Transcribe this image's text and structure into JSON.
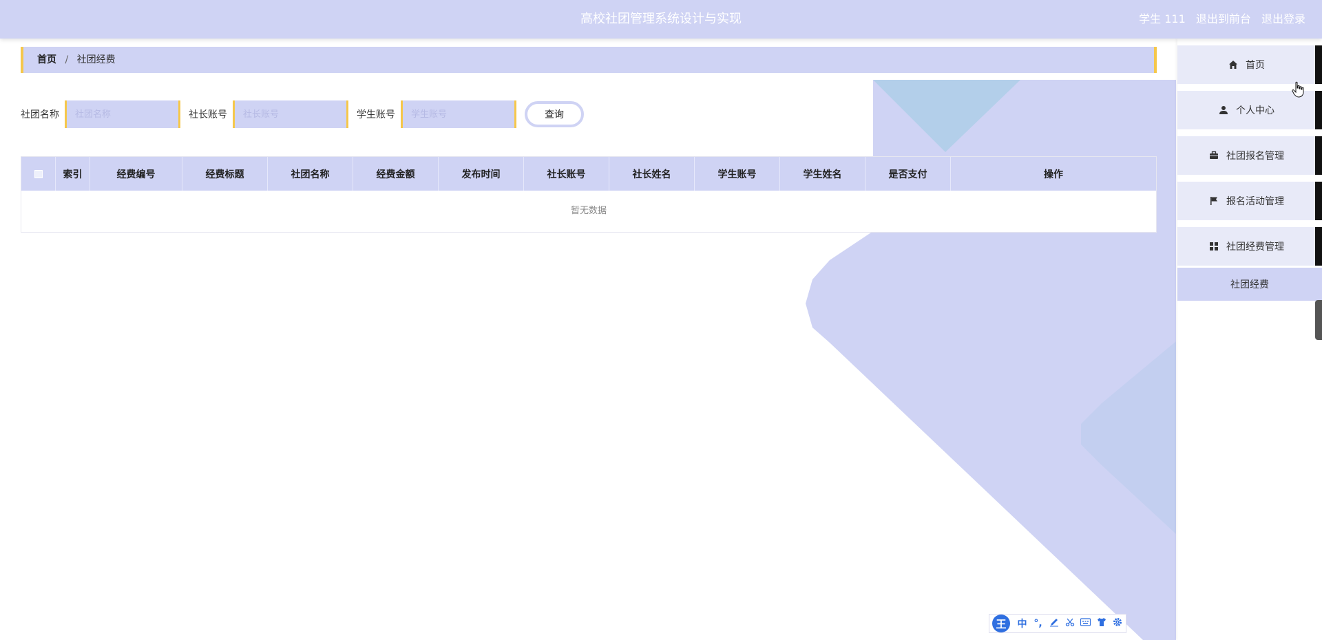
{
  "header": {
    "title": "高校社团管理系统设计与实现",
    "user": "学生 111",
    "back_link": "退出到前台",
    "logout_link": "退出登录"
  },
  "breadcrumb": {
    "home": "首页",
    "separator": "/",
    "current": "社团经费"
  },
  "search": {
    "club_name_label": "社团名称",
    "club_name_placeholder": "社团名称",
    "president_account_label": "社长账号",
    "president_account_placeholder": "社长账号",
    "student_account_label": "学生账号",
    "student_account_placeholder": "学生账号",
    "query_button": "查询"
  },
  "table": {
    "columns": [
      "索引",
      "经费编号",
      "经费标题",
      "社团名称",
      "经费金额",
      "发布时间",
      "社长账号",
      "社长姓名",
      "学生账号",
      "学生姓名",
      "是否支付",
      "操作"
    ],
    "empty_text": "暂无数据"
  },
  "sidebar": {
    "items": [
      {
        "label": "首页",
        "icon": "home-icon"
      },
      {
        "label": "个人中心",
        "icon": "user-icon"
      },
      {
        "label": "社团报名管理",
        "icon": "briefcase-icon"
      },
      {
        "label": "报名活动管理",
        "icon": "flag-icon"
      },
      {
        "label": "社团经费管理",
        "icon": "grid-icon"
      }
    ],
    "active_sub_item": "社团经费"
  },
  "ime_toolbar": {
    "logo": "王",
    "lang": "中",
    "punct": "°,"
  },
  "colors": {
    "accent": "#cfd3f4",
    "border_accent": "#f5c74b",
    "ime_blue": "#2f6fe0"
  }
}
